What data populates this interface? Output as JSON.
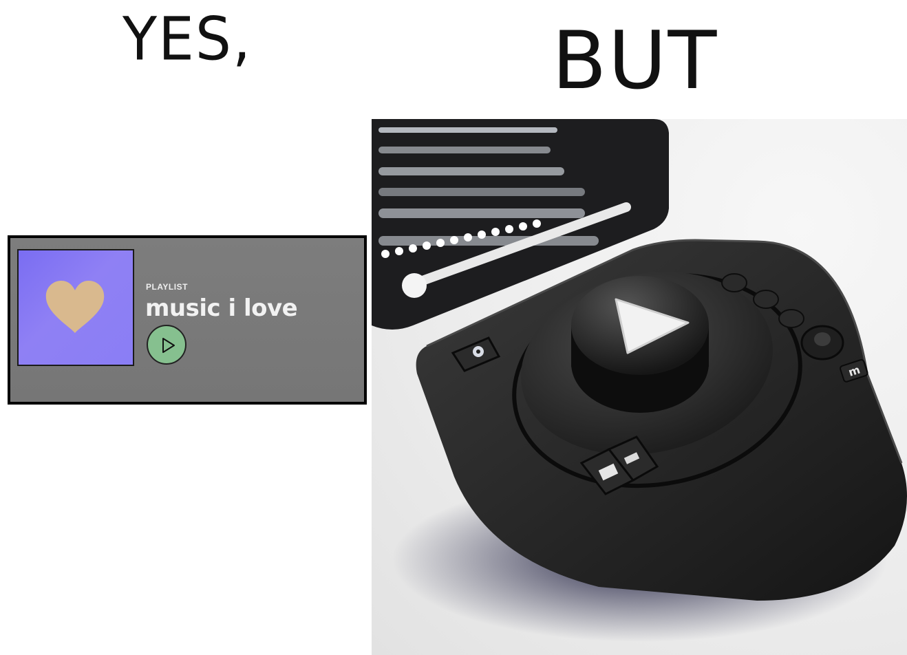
{
  "headings": {
    "left": "YES,",
    "right": "BUT"
  },
  "playlist_card": {
    "kind_label": "PLAYLIST",
    "title": "music i love",
    "cover_icon": "heart-icon",
    "play_icon": "play-icon",
    "cover_color": "#8579f3",
    "heart_color": "#d9b98e",
    "play_button_color": "#86c08f"
  },
  "illustration": {
    "subject": "turntable-device",
    "main_button_icon": "play-icon",
    "corner_badge_text": "m"
  }
}
